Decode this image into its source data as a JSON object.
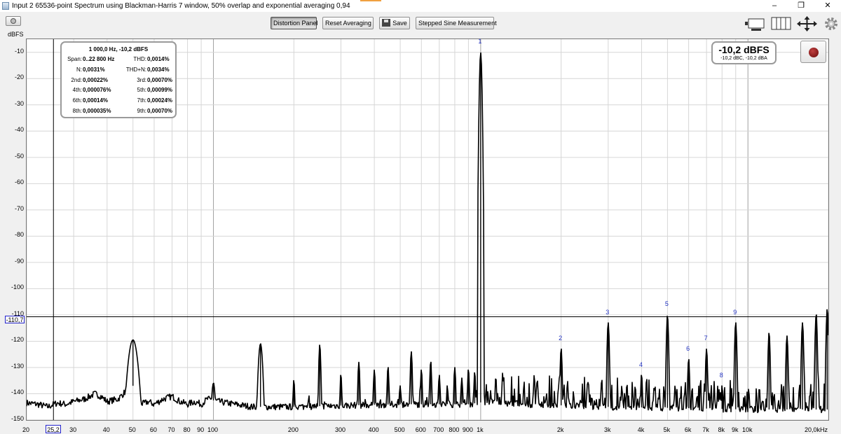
{
  "window": {
    "title": "Input 2 65536-point Spectrum using Blackman-Harris 7 window, 50% overlap and exponential averaging 0,94",
    "minimize": "–",
    "restore": "❐",
    "close": "✕"
  },
  "toolbar": {
    "unit_label": "dBFS",
    "distortion_panel": "Distortion Panel",
    "reset_averaging": "Reset Averaging",
    "save": "Save",
    "stepped_sine": "Stepped Sine Measurement"
  },
  "stats_panel": {
    "header": "1 000,0 Hz, -10,2 dBFS",
    "rows": [
      {
        "k1": "Span:",
        "v1": "0..22 800 Hz",
        "k2": "THD:",
        "v2": "0,0014%"
      },
      {
        "k1": "N:",
        "v1": "0,0031%",
        "k2": "THD+N:",
        "v2": "0,0034%"
      },
      {
        "k1": "2nd:",
        "v1": "0,00022%",
        "k2": "3rd:",
        "v2": "0,00070%"
      },
      {
        "k1": "4th:",
        "v1": "0,000076%",
        "k2": "5th:",
        "v2": "0,00099%"
      },
      {
        "k1": "6th:",
        "v1": "0,00014%",
        "k2": "7th:",
        "v2": "0,00024%"
      },
      {
        "k1": "8th:",
        "v1": "0,000035%",
        "k2": "9th:",
        "v2": "0,00070%"
      }
    ]
  },
  "level_box": {
    "value": "-10,2 dBFS",
    "sub": "-10,2 dBC, -10,2 dBA"
  },
  "cursor": {
    "level_label": "-110,7",
    "level_value": -110.7,
    "freq_label": "25,2",
    "freq_value": 25.2
  },
  "chart_data": {
    "type": "line",
    "title": "",
    "xlabel": "",
    "ylabel": "dBFS",
    "x_scale": "log",
    "xlim": [
      20,
      20000
    ],
    "ylim": [
      -150,
      -5
    ],
    "grid": true,
    "y_ticks": [
      -10,
      -20,
      -30,
      -40,
      -50,
      -60,
      -70,
      -80,
      -90,
      -100,
      -110,
      -120,
      -130,
      -140,
      -150
    ],
    "y_tick_labels": [
      "-10",
      "-20",
      "-30",
      "-40",
      "-50",
      "-60",
      "-70",
      "-80",
      "-90",
      "-100",
      "-110",
      "-120",
      "-130",
      "-140",
      "-150"
    ],
    "x_ticks": [
      20,
      30,
      40,
      50,
      60,
      70,
      80,
      90,
      100,
      200,
      300,
      400,
      500,
      600,
      700,
      800,
      900,
      1000,
      2000,
      3000,
      4000,
      5000,
      6000,
      7000,
      8000,
      9000,
      10000,
      20000
    ],
    "x_tick_labels": [
      "20",
      "30",
      "40",
      "50",
      "60",
      "70",
      "80",
      "90",
      "100",
      "200",
      "300",
      "400",
      "500",
      "600",
      "700",
      "800",
      "900",
      "1k",
      "2k",
      "3k",
      "4k",
      "5k",
      "6k",
      "7k",
      "8k",
      "9k",
      "10k",
      "20,0kHz"
    ],
    "series": [
      {
        "line_color": "#000000",
        "noise_floor": [
          [
            20,
            -143.5
          ],
          [
            22,
            -144
          ],
          [
            24,
            -145
          ],
          [
            26,
            -143.5
          ],
          [
            28,
            -144
          ],
          [
            30,
            -143
          ],
          [
            33,
            -142
          ],
          [
            36,
            -140
          ],
          [
            38,
            -141
          ],
          [
            40,
            -143
          ],
          [
            44,
            -142
          ],
          [
            46,
            -140
          ],
          [
            48,
            -138
          ],
          [
            52,
            -136
          ],
          [
            54,
            -144
          ],
          [
            57,
            -143
          ],
          [
            60,
            -144
          ],
          [
            65,
            -142
          ],
          [
            70,
            -141
          ],
          [
            75,
            -143
          ],
          [
            80,
            -144
          ],
          [
            85,
            -143
          ],
          [
            90,
            -144
          ],
          [
            95,
            -142
          ],
          [
            105,
            -143
          ],
          [
            120,
            -144
          ],
          [
            140,
            -145
          ],
          [
            200,
            -145
          ],
          [
            300,
            -144.5
          ],
          [
            500,
            -144
          ],
          [
            700,
            -144
          ],
          [
            900,
            -144
          ],
          [
            1050,
            -143
          ],
          [
            1500,
            -144
          ],
          [
            3000,
            -145
          ],
          [
            6000,
            -145.5
          ],
          [
            10000,
            -146
          ],
          [
            20000,
            -146
          ]
        ],
        "peaks": [
          {
            "freq": 50,
            "level": -119.5
          },
          {
            "freq": 100,
            "level": -136
          },
          {
            "freq": 150,
            "level": -121
          },
          {
            "freq": 200,
            "level": -135
          },
          {
            "freq": 250,
            "level": -121.5
          },
          {
            "freq": 300,
            "level": -133
          },
          {
            "freq": 350,
            "level": -128
          },
          {
            "freq": 400,
            "level": -131
          },
          {
            "freq": 450,
            "level": -130
          },
          {
            "freq": 500,
            "level": -137
          },
          {
            "freq": 550,
            "level": -124
          },
          {
            "freq": 600,
            "level": -131
          },
          {
            "freq": 650,
            "level": -128
          },
          {
            "freq": 700,
            "level": -133
          },
          {
            "freq": 750,
            "level": -137
          },
          {
            "freq": 800,
            "level": -130
          },
          {
            "freq": 850,
            "level": -134
          },
          {
            "freq": 900,
            "level": -131
          },
          {
            "freq": 950,
            "level": -132
          },
          {
            "freq": 1000,
            "level": -10.2
          },
          {
            "freq": 2000,
            "level": -123
          },
          {
            "freq": 3000,
            "level": -113
          },
          {
            "freq": 4000,
            "level": -133
          },
          {
            "freq": 5000,
            "level": -110.5
          },
          {
            "freq": 6000,
            "level": -127
          },
          {
            "freq": 7000,
            "level": -123
          },
          {
            "freq": 8000,
            "level": -137
          },
          {
            "freq": 9000,
            "level": -113
          },
          {
            "freq": 12000,
            "level": -117
          },
          {
            "freq": 14000,
            "level": -118
          },
          {
            "freq": 16000,
            "level": -113
          },
          {
            "freq": 18000,
            "level": -110
          },
          {
            "freq": 19800,
            "level": -108
          }
        ]
      }
    ],
    "annotations": [
      {
        "text": "1",
        "freq": 1000,
        "level": -8
      },
      {
        "text": "2",
        "freq": 2000,
        "level": -121
      },
      {
        "text": "3",
        "freq": 3000,
        "level": -111
      },
      {
        "text": "4",
        "freq": 4000,
        "level": -131
      },
      {
        "text": "5",
        "freq": 5000,
        "level": -108
      },
      {
        "text": "6",
        "freq": 6000,
        "level": -125
      },
      {
        "text": "7",
        "freq": 7000,
        "level": -121
      },
      {
        "text": "8",
        "freq": 8000,
        "level": -135
      },
      {
        "text": "9",
        "freq": 9000,
        "level": -111
      }
    ]
  }
}
